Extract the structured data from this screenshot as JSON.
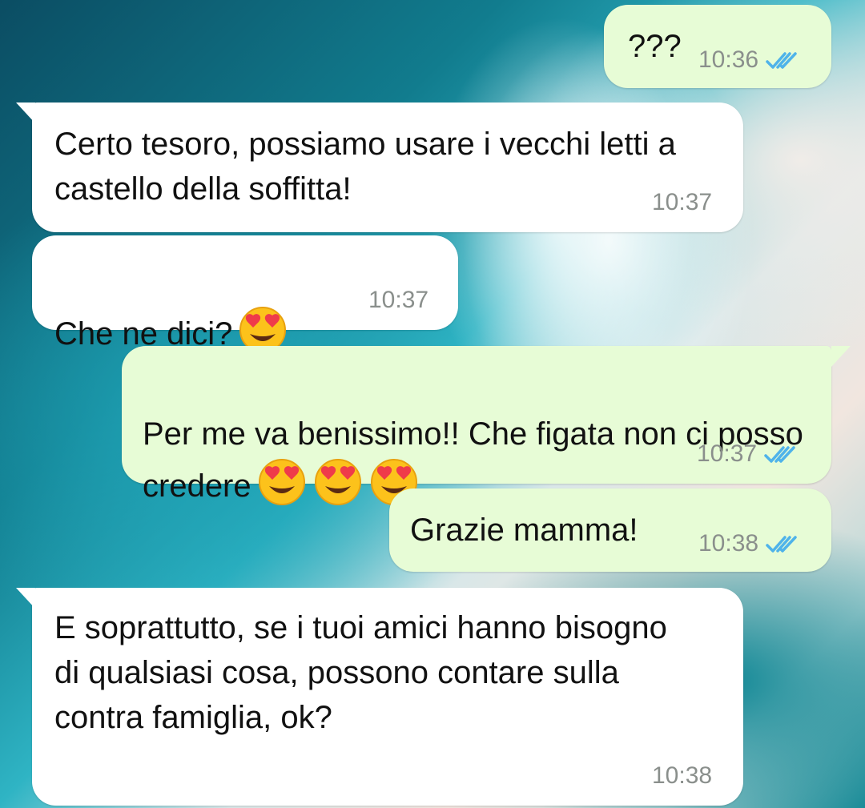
{
  "messages": [
    {
      "text": "???",
      "time": "10:36",
      "direction": "out",
      "status": "read"
    },
    {
      "text": "Certo tesoro, possiamo usare i vecchi letti a castello della soffitta!",
      "time": "10:37",
      "direction": "in"
    },
    {
      "text": "Che ne dici?",
      "emoji": "heart-eyes",
      "time": "10:37",
      "direction": "in"
    },
    {
      "text": "Per me va benissimo!! Che figata non ci posso credere",
      "emoji": "heart-eyes x3",
      "time": "10:37",
      "direction": "out",
      "status": "read"
    },
    {
      "text": "Grazie mamma!",
      "time": "10:38",
      "direction": "out",
      "status": "read"
    },
    {
      "text": "E soprattutto, se i tuoi amici hanno bisogno di qualsiasi cosa, possono contare sulla contra famiglia, ok?",
      "time": "10:38",
      "direction": "in"
    }
  ],
  "colors": {
    "incoming_bubble": "#ffffff",
    "outgoing_bubble": "#e7fcd6",
    "read_ticks": "#4fb3ea",
    "timestamp": "#8a8f8c"
  }
}
